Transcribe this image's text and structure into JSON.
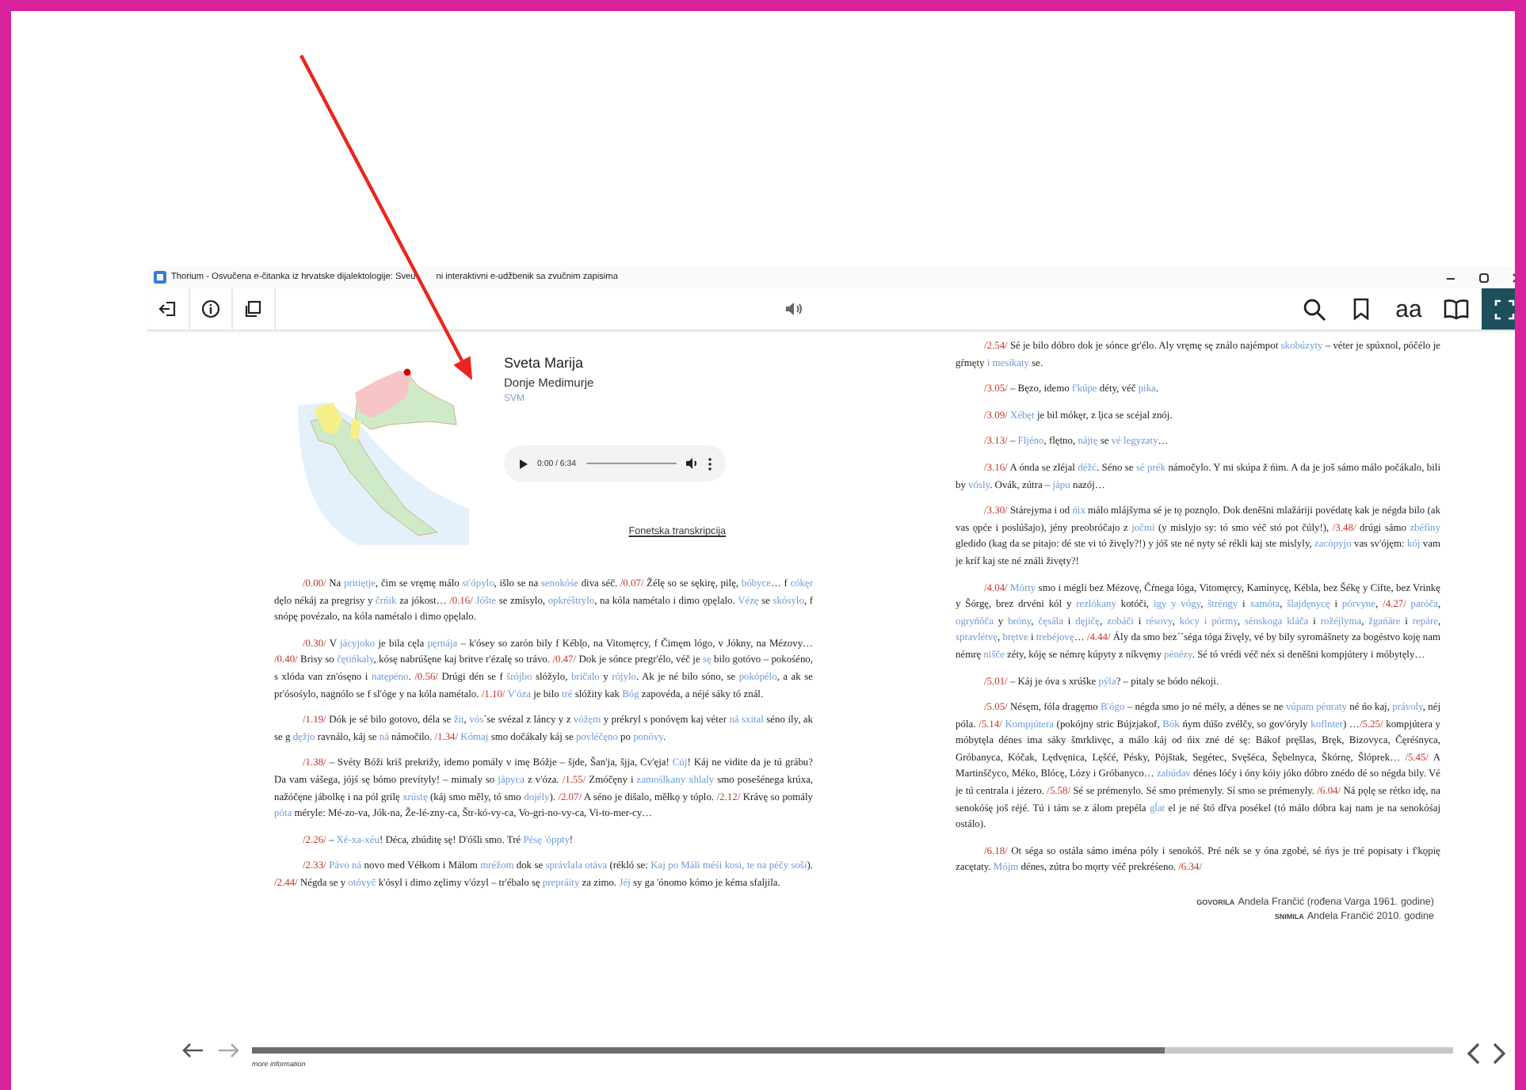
{
  "window": {
    "title_parts": [
      "Thorium - Osvučena e-čitanka iz hrvatske dijalektologije: Sveu",
      "ni interaktivni e-udžbenik sa zvučnim zapisima"
    ]
  },
  "toolbar": {
    "left_buttons": [
      {
        "kind": "exit"
      },
      {
        "kind": "info"
      },
      {
        "kind": "toc"
      }
    ],
    "right_buttons": [
      {
        "kind": "search",
        "selected": false
      },
      {
        "kind": "bookmark",
        "selected": false
      },
      {
        "kind": "text-size",
        "label": "aa",
        "selected": false
      },
      {
        "kind": "reader",
        "selected": false
      },
      {
        "kind": "fullscreen",
        "selected": true
      }
    ]
  },
  "header": {
    "place": "Sveta Marija",
    "region": "Donje Medimurje",
    "code": "SVM",
    "audio_time": "0:00 / 6:34",
    "transcription_link": "Fonetska transkripcija"
  },
  "left_paragraphs": [
    {
      "segments": [
        {
          "kind": "time",
          "text": "/0.00/"
        },
        {
          "kind": "plain",
          "text": " Na "
        },
        {
          "kind": "gloss",
          "text": "pritiętje"
        },
        {
          "kind": "plain",
          "text": ", čim se vręmę málo "
        },
        {
          "kind": "gloss",
          "text": "st'ópylo"
        },
        {
          "kind": "plain",
          "text": ", išlo se na "
        },
        {
          "kind": "gloss",
          "text": "senokóśe"
        },
        {
          "kind": "plain",
          "text": " diva séč. "
        },
        {
          "kind": "time",
          "text": "/0.07/"
        },
        {
          "kind": "plain",
          "text": " Žélę so se sękirę, pilę, "
        },
        {
          "kind": "gloss",
          "text": "bóbyce"
        },
        {
          "kind": "plain",
          "text": "… f "
        },
        {
          "kind": "gloss",
          "text": "cókęr"
        },
        {
          "kind": "plain",
          "text": " dęlo nékáj za pregrisy y "
        },
        {
          "kind": "gloss",
          "text": "črńik"
        },
        {
          "kind": "plain",
          "text": " za jókost… "
        },
        {
          "kind": "time",
          "text": "/0.16/ "
        },
        {
          "kind": "gloss",
          "text": "Jóšte"
        },
        {
          "kind": "plain",
          "text": " se zmísylo, "
        },
        {
          "kind": "gloss",
          "text": "opkréštrylo"
        },
        {
          "kind": "plain",
          "text": ", na kóla namétalo i dimo ǫpęlalo. "
        },
        {
          "kind": "gloss",
          "text": "Vézę"
        },
        {
          "kind": "plain",
          "text": " se "
        },
        {
          "kind": "gloss",
          "text": "skósylo"
        },
        {
          "kind": "plain",
          "text": ", f snópę povézalo, na kóla namétalo i dimo ǫpęlalo."
        }
      ]
    },
    {
      "segments": [
        {
          "kind": "time",
          "text": "/0.30/"
        },
        {
          "kind": "plain",
          "text": " V "
        },
        {
          "kind": "gloss",
          "text": "jácyjoko"
        },
        {
          "kind": "plain",
          "text": " je bila cęla "
        },
        {
          "kind": "gloss",
          "text": "pęrnája"
        },
        {
          "kind": "plain",
          "text": " – k'ósey so zarón bily f Kébl̦o, na Vitomęrcy, f Čimęm lógo, v Jókny, na Mézovy… "
        },
        {
          "kind": "time",
          "text": "/0.40/"
        },
        {
          "kind": "plain",
          "text": " Brisy so "
        },
        {
          "kind": "gloss",
          "text": "čętińkaly"
        },
        {
          "kind": "plain",
          "text": ", kósę nabrúšęne kaj britve r'ézalę so trávo. "
        },
        {
          "kind": "time",
          "text": "/0.47/"
        },
        {
          "kind": "plain",
          "text": " Dok je sónce pregr'élo, véč je "
        },
        {
          "kind": "gloss",
          "text": "sę"
        },
        {
          "kind": "plain",
          "text": " bilo gotóvo – pokośéno, s xlóda van zn'ósęno i "
        },
        {
          "kind": "gloss",
          "text": "natępéno"
        },
        {
          "kind": "plain",
          "text": ". "
        },
        {
          "kind": "time",
          "text": "/0.56/"
        },
        {
          "kind": "plain",
          "text": " Drúgi dén se f "
        },
        {
          "kind": "gloss",
          "text": "šrójbo"
        },
        {
          "kind": "plain",
          "text": " slóžylo, "
        },
        {
          "kind": "gloss",
          "text": "bričalo"
        },
        {
          "kind": "plain",
          "text": " y "
        },
        {
          "kind": "gloss",
          "text": "rójylo"
        },
        {
          "kind": "plain",
          "text": ". Ak je né bilo sóno, se "
        },
        {
          "kind": "gloss",
          "text": "pokópélo"
        },
        {
          "kind": "plain",
          "text": ", a ak se pr'ósośylo, nagnólo se f sl'óge y na kóla namétalo. "
        },
        {
          "kind": "time",
          "text": "/1.10/ "
        },
        {
          "kind": "gloss",
          "text": "V'óza"
        },
        {
          "kind": "plain",
          "text": " je bilo "
        },
        {
          "kind": "gloss",
          "text": "tré"
        },
        {
          "kind": "plain",
          "text": " slóžity kak "
        },
        {
          "kind": "gloss",
          "text": "Bóg"
        },
        {
          "kind": "plain",
          "text": " zapovéda, a néjé sáky tó znál."
        }
      ]
    },
    {
      "segments": [
        {
          "kind": "time",
          "text": "/1.19/"
        },
        {
          "kind": "plain",
          "text": " Dók je sé bilo gotovo, déla se "
        },
        {
          "kind": "gloss",
          "text": "žit"
        },
        {
          "kind": "plain",
          "text": ", "
        },
        {
          "kind": "gloss",
          "text": "vós"
        },
        {
          "kind": "plain",
          "text": "´se svézal z láncy y z "
        },
        {
          "kind": "gloss",
          "text": "vóžęm"
        },
        {
          "kind": "plain",
          "text": " y prékryl s ponóvęm kaj véter "
        },
        {
          "kind": "gloss",
          "text": "ná sxital"
        },
        {
          "kind": "plain",
          "text": " séno ily, ak se g "
        },
        {
          "kind": "gloss",
          "text": "dęžjo"
        },
        {
          "kind": "plain",
          "text": " ravnálo, káj se "
        },
        {
          "kind": "gloss",
          "text": "ná"
        },
        {
          "kind": "plain",
          "text": " námočilo. "
        },
        {
          "kind": "time",
          "text": "/1.34/ "
        },
        {
          "kind": "gloss",
          "text": "Kómaj"
        },
        {
          "kind": "plain",
          "text": " smo dočákaly káj se "
        },
        {
          "kind": "gloss",
          "text": "povléčęno"
        },
        {
          "kind": "plain",
          "text": " po "
        },
        {
          "kind": "gloss",
          "text": "ponóvy"
        },
        {
          "kind": "plain",
          "text": "."
        }
      ]
    },
    {
      "segments": [
        {
          "kind": "time",
          "text": "/1.38/"
        },
        {
          "kind": "plain",
          "text": " – Svéty Bóži kriš prekrižy, idemo pomály v imę Bóžje – šjde, Šan'ja, šjja, Cv'ęja! "
        },
        {
          "kind": "gloss",
          "text": "Cúj"
        },
        {
          "kind": "plain",
          "text": "! Káj ne vidite da je tú grábu? Da vam vášega, jójś sę bómo prevítyly! – mimaly so "
        },
        {
          "kind": "gloss",
          "text": "jápyca"
        },
        {
          "kind": "plain",
          "text": " z v'óza. "
        },
        {
          "kind": "time",
          "text": "/1.55/"
        },
        {
          "kind": "plain",
          "text": " Zmóčęny i "
        },
        {
          "kind": "gloss",
          "text": "zamoślkany xhlaly"
        },
        {
          "kind": "plain",
          "text": " smo posešénega krúxa, nažóčęne jábolkę i na pól grilę "
        },
        {
          "kind": "gloss",
          "text": "xrústę"
        },
        {
          "kind": "plain",
          "text": " (káj smo měly, tó smo "
        },
        {
          "kind": "gloss",
          "text": "dojély"
        },
        {
          "kind": "plain",
          "text": "). "
        },
        {
          "kind": "time",
          "text": "/2.07/"
        },
        {
          "kind": "plain",
          "text": " A séno je dišalo, měłkǫ y tóplo. "
        },
        {
          "kind": "time",
          "text": "/2.12/"
        },
        {
          "kind": "plain",
          "text": " Krávę so pomály "
        },
        {
          "kind": "gloss",
          "text": "póta"
        },
        {
          "kind": "plain",
          "text": " méryle: Mé-zo-va, Jók-na, Že-lé-zny-ca, Štr-kó-vy-ca, Vo-gri-no-vy-ca, Vi-to-mer-cy…"
        }
      ]
    },
    {
      "segments": [
        {
          "kind": "time",
          "text": "/2.26/"
        },
        {
          "kind": "plain",
          "text": " – "
        },
        {
          "kind": "gloss",
          "text": "Xé-xa-xéu"
        },
        {
          "kind": "plain",
          "text": "! Déca, zbúditę sę! D'óšli smo. Tré "
        },
        {
          "kind": "gloss",
          "text": "Pésę 'óppty"
        },
        {
          "kind": "plain",
          "text": "!"
        }
      ]
    },
    {
      "segments": [
        {
          "kind": "time",
          "text": "/2.33/ "
        },
        {
          "kind": "gloss",
          "text": "Pávo ná"
        },
        {
          "kind": "plain",
          "text": " novo med Véłkom i Málom "
        },
        {
          "kind": "gloss",
          "text": "mréžom"
        },
        {
          "kind": "plain",
          "text": " dok se "
        },
        {
          "kind": "gloss",
          "text": "správlala otáva"
        },
        {
          "kind": "plain",
          "text": " (rékló se: "
        },
        {
          "kind": "gloss",
          "text": "Kaj po Máli méśi kosi, te na péčy soši"
        },
        {
          "kind": "plain",
          "text": "). "
        },
        {
          "kind": "time",
          "text": "/2.44/"
        },
        {
          "kind": "plain",
          "text": " Négda se y "
        },
        {
          "kind": "gloss",
          "text": "otóvyč"
        },
        {
          "kind": "plain",
          "text": " k'ósyl i dimo zęlimy v'ózyl – tr'ébalo sę "
        },
        {
          "kind": "gloss",
          "text": "prepráity"
        },
        {
          "kind": "plain",
          "text": " za zimo. "
        },
        {
          "kind": "gloss",
          "text": "Jéj"
        },
        {
          "kind": "plain",
          "text": " sy ga 'ónomo kómo je kéma sfaljila."
        }
      ]
    }
  ],
  "right_paragraphs": [
    {
      "segments": [
        {
          "kind": "time",
          "text": "/2.54/"
        },
        {
          "kind": "plain",
          "text": " Sé je bilo dóbro dok je sónce gr'élo. Aly vręmę sę ználo najémpot "
        },
        {
          "kind": "gloss",
          "text": "skobúzyty"
        },
        {
          "kind": "plain",
          "text": " – véter je spúxnol, póčélo je gŕmęty "
        },
        {
          "kind": "gloss",
          "text": "i mesikaty"
        },
        {
          "kind": "plain",
          "text": " se."
        }
      ]
    },
    {
      "segments": [
        {
          "kind": "time",
          "text": "/3.05/"
        },
        {
          "kind": "plain",
          "text": " – Bęzo, idemo "
        },
        {
          "kind": "gloss",
          "text": "f'kúpe"
        },
        {
          "kind": "plain",
          "text": " déty, véč "
        },
        {
          "kind": "gloss",
          "text": "pika"
        },
        {
          "kind": "plain",
          "text": "."
        }
      ]
    },
    {
      "segments": [
        {
          "kind": "time",
          "text": "/3.09/ "
        },
        {
          "kind": "gloss",
          "text": "Xébęt"
        },
        {
          "kind": "plain",
          "text": " je bil mókęr, z l̦ica se scéjal znój."
        }
      ]
    },
    {
      "segments": [
        {
          "kind": "time",
          "text": "/3.13/"
        },
        {
          "kind": "plain",
          "text": " – "
        },
        {
          "kind": "gloss",
          "text": "Fljéno"
        },
        {
          "kind": "plain",
          "text": ", flętno, "
        },
        {
          "kind": "gloss",
          "text": "nájtę"
        },
        {
          "kind": "plain",
          "text": " se "
        },
        {
          "kind": "gloss",
          "text": "vé legyzaty"
        },
        {
          "kind": "plain",
          "text": "…"
        }
      ]
    },
    {
      "segments": [
        {
          "kind": "time",
          "text": "/3.16/"
        },
        {
          "kind": "plain",
          "text": " A ónda se zléjal "
        },
        {
          "kind": "gloss",
          "text": "déžć"
        },
        {
          "kind": "plain",
          "text": ". Séno se "
        },
        {
          "kind": "gloss",
          "text": "sé prék"
        },
        {
          "kind": "plain",
          "text": " námočylo. Y mi skúpa ž ńim. A da je još sámo málo počákalo, bili by "
        },
        {
          "kind": "gloss",
          "text": "vósly"
        },
        {
          "kind": "plain",
          "text": ". Ovák, zútra – "
        },
        {
          "kind": "gloss",
          "text": "jápu"
        },
        {
          "kind": "plain",
          "text": " nazój…"
        }
      ]
    },
    {
      "segments": [
        {
          "kind": "time",
          "text": "/3.30/"
        },
        {
          "kind": "plain",
          "text": " Stárejyma i od "
        },
        {
          "kind": "gloss",
          "text": "ńix"
        },
        {
          "kind": "plain",
          "text": " málo mlájšyma sé je tǫ poznǫlo. Dok deněšni mlažáriji povédatę kak je négda bilo (ak vas ǫpće i poslúšajo), jény preobróčajo z "
        },
        {
          "kind": "gloss",
          "text": "jočmí"
        },
        {
          "kind": "plain",
          "text": " (y mislyjo sy: tó smo véč stó pot čúly!), "
        },
        {
          "kind": "time",
          "text": "/3.48/"
        },
        {
          "kind": "plain",
          "text": " drúgi sámo "
        },
        {
          "kind": "gloss",
          "text": "zbéfiny"
        },
        {
          "kind": "plain",
          "text": " gledido (kag da se pitajo: dé ste vi tó živęly?!) y jóš ste né nyty sé rékli kaj ste mislyly, "
        },
        {
          "kind": "gloss",
          "text": "zacópyjo"
        },
        {
          "kind": "plain",
          "text": " vas sv'ójęm: "
        },
        {
          "kind": "gloss",
          "text": "kój"
        },
        {
          "kind": "plain",
          "text": " vam je kríf kaj ste né ználi živęty?!"
        }
      ]
    },
    {
      "segments": [
        {
          "kind": "time",
          "text": "/4.04/ "
        },
        {
          "kind": "gloss",
          "text": "Mórty"
        },
        {
          "kind": "plain",
          "text": " smo i mégli bez Mézovę, Čŕnega lóga, Vitomęrcy, Kamínycę, Kébla, bez Šékę y Cífte, bez Vrinkę y Šórgę, brez drvéni kól y "
        },
        {
          "kind": "gloss",
          "text": "rezlókany"
        },
        {
          "kind": "plain",
          "text": " kotóči, "
        },
        {
          "kind": "gloss",
          "text": "igy y vógy"
        },
        {
          "kind": "plain",
          "text": ", "
        },
        {
          "kind": "gloss",
          "text": "štréngy"
        },
        {
          "kind": "plain",
          "text": " i "
        },
        {
          "kind": "gloss",
          "text": "xamóta"
        },
        {
          "kind": "plain",
          "text": ", "
        },
        {
          "kind": "gloss",
          "text": "šlajdęnycę"
        },
        {
          "kind": "plain",
          "text": " i "
        },
        {
          "kind": "gloss",
          "text": "pórvyne"
        },
        {
          "kind": "plain",
          "text": ", "
        },
        {
          "kind": "time",
          "text": "/4.27/ "
        },
        {
          "kind": "gloss",
          "text": "paróča"
        },
        {
          "kind": "plain",
          "text": ", "
        },
        {
          "kind": "gloss",
          "text": "ogryńóča"
        },
        {
          "kind": "plain",
          "text": " y "
        },
        {
          "kind": "gloss",
          "text": "bróny"
        },
        {
          "kind": "plain",
          "text": ", "
        },
        {
          "kind": "gloss",
          "text": "čęsála"
        },
        {
          "kind": "plain",
          "text": " i "
        },
        {
          "kind": "gloss",
          "text": "dęjičę"
        },
        {
          "kind": "plain",
          "text": ", "
        },
        {
          "kind": "gloss",
          "text": "zobáči"
        },
        {
          "kind": "plain",
          "text": " i "
        },
        {
          "kind": "gloss",
          "text": "résovy"
        },
        {
          "kind": "plain",
          "text": ", "
        },
        {
          "kind": "gloss",
          "text": "kócy i pórmy"
        },
        {
          "kind": "plain",
          "text": ", "
        },
        {
          "kind": "gloss",
          "text": "sénskoga kláča"
        },
        {
          "kind": "plain",
          "text": " i "
        },
        {
          "kind": "gloss",
          "text": "rožéjlyma"
        },
        {
          "kind": "plain",
          "text": ", "
        },
        {
          "kind": "gloss",
          "text": "žgańáre"
        },
        {
          "kind": "plain",
          "text": " i "
        },
        {
          "kind": "gloss",
          "text": "repáre"
        },
        {
          "kind": "plain",
          "text": ", "
        },
        {
          "kind": "gloss",
          "text": "spravlétvę"
        },
        {
          "kind": "plain",
          "text": ", "
        },
        {
          "kind": "gloss",
          "text": "brętve"
        },
        {
          "kind": "plain",
          "text": " i "
        },
        {
          "kind": "gloss",
          "text": "trebéjovę"
        },
        {
          "kind": "plain",
          "text": "… "
        },
        {
          "kind": "time",
          "text": "/4.44/"
        },
        {
          "kind": "plain",
          "text": " Ály da smo bez´´séga tóga živęly, vé by bily syromášnety za bogéstvo koję nam némrę "
        },
        {
          "kind": "gloss",
          "text": "nišče"
        },
        {
          "kind": "plain",
          "text": " zéty, kóję se némrę kúpyty z níkvęmy "
        },
        {
          "kind": "gloss",
          "text": "pénézy"
        },
        {
          "kind": "plain",
          "text": ". Sé tó vrédi véč néx si deněšni kompjútery i móbytęly…"
        }
      ]
    },
    {
      "segments": [
        {
          "kind": "time",
          "text": "/5.01/"
        },
        {
          "kind": "plain",
          "text": " – Káj je óva s xrúške "
        },
        {
          "kind": "gloss",
          "text": "pýla"
        },
        {
          "kind": "plain",
          "text": "? – pitaly se bódo nékoji."
        }
      ]
    },
    {
      "segments": [
        {
          "kind": "time",
          "text": "/5.05/"
        },
        {
          "kind": "plain",
          "text": " Nésęm, fóla dragęmo "
        },
        {
          "kind": "gloss",
          "text": "B'ógo"
        },
        {
          "kind": "plain",
          "text": " – négda smo jo né mély, a dénes se ne "
        },
        {
          "kind": "gloss",
          "text": "vúpam pénraty"
        },
        {
          "kind": "plain",
          "text": " né ńo kaj, "
        },
        {
          "kind": "gloss",
          "text": "právoly"
        },
        {
          "kind": "plain",
          "text": ", néj póla. "
        },
        {
          "kind": "time",
          "text": "/5.14/ "
        },
        {
          "kind": "gloss",
          "text": "Kompjútera"
        },
        {
          "kind": "plain",
          "text": " (pokójny stric Bújzjakof, "
        },
        {
          "kind": "gloss",
          "text": "Bók"
        },
        {
          "kind": "plain",
          "text": " ńym dúšo zvélčy, so gov'óryly "
        },
        {
          "kind": "gloss",
          "text": "koflnter"
        },
        {
          "kind": "plain",
          "text": ") …"
        },
        {
          "kind": "time",
          "text": "/5.25/"
        },
        {
          "kind": "plain",
          "text": " kompjútera y móbytęla dénes ima sáky šmrklivęc, a málo káj od ńix zné dé sę: Bákof pręšlas, Bręk, Bizovyca, Čęréśnyca, Gróbanyca, Kóčak, Lędvęnica, Lęšćé, Pésky, Pójštak, Segétec, Svęšéca, Šębelnyca, Škórnę, Šlóprek… "
        },
        {
          "kind": "time",
          "text": "/5.45/"
        },
        {
          "kind": "plain",
          "text": " A Martinščyco, Méko, Blócę, Lózy i Gróbanyco… "
        },
        {
          "kind": "gloss",
          "text": "zabúdav"
        },
        {
          "kind": "plain",
          "text": " dénes lóćy i óny kóiy jóko dóbro znédo dé so négda bily. Vé je tú centrala i jézero. "
        },
        {
          "kind": "time",
          "text": "/5.58/"
        },
        {
          "kind": "plain",
          "text": " Sé se prémenylo. Sé smo prémenyly. Sí smo se prémenyly. "
        },
        {
          "kind": "time",
          "text": "/6.04/"
        },
        {
          "kind": "plain",
          "text": " Ná pǫlę se rétko idę, na senokóśę još réjé. Tú i tám se z álom prepéla "
        },
        {
          "kind": "gloss",
          "text": "gĺat"
        },
        {
          "kind": "plain",
          "text": " el je né štó dřva posékel (tó málo dóbra kaj nam je na senokóśaj ostálo)."
        }
      ]
    },
    {
      "segments": [
        {
          "kind": "time",
          "text": "/6.18/"
        },
        {
          "kind": "plain",
          "text": " Ot séga so ostála sámo iména póly i senokóš. Pré nék se y óna zgobé, sé ńys je tré popisaty i f'kǫpię zacętaty. "
        },
        {
          "kind": "gloss",
          "text": "Mójm"
        },
        {
          "kind": "plain",
          "text": " dénes, zútra bo mǫrty véč prekréśeno. "
        },
        {
          "kind": "time",
          "text": "/6.34/"
        }
      ]
    }
  ],
  "credits": [
    {
      "label": "GOVORILA",
      "text": "Andela Frančić (rođena Varga 1961. godine)"
    },
    {
      "label": "SNIMILA",
      "text": "Andela Frančić 2010. godine"
    }
  ],
  "footer": {
    "more_info": "more information",
    "level": 0.76
  }
}
